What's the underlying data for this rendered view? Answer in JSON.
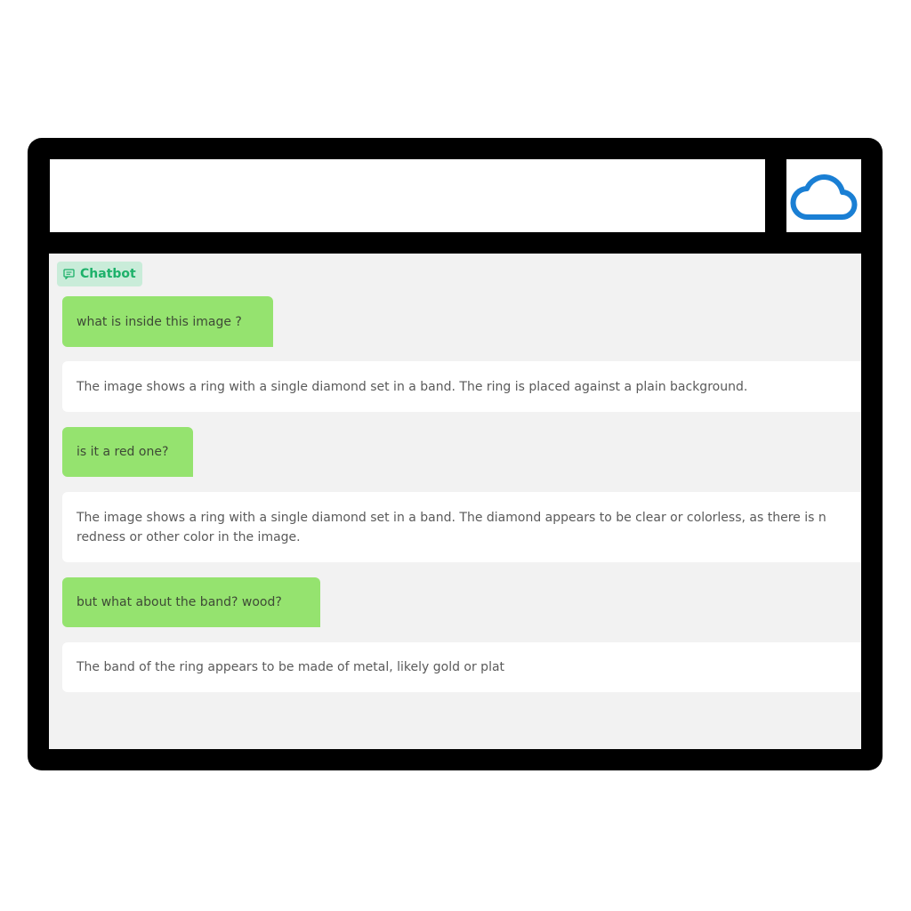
{
  "chat": {
    "label": "Chatbot",
    "messages": [
      {
        "role": "user",
        "text": "what is inside this image ?"
      },
      {
        "role": "bot",
        "lines": [
          "The image shows a ring with a single diamond set in a band. The ring is placed against a plain background."
        ]
      },
      {
        "role": "user",
        "text": "is it a red one?"
      },
      {
        "role": "bot",
        "lines": [
          "The image shows a ring with a single diamond set in a band. The diamond appears to be clear or colorless, as there is n",
          "redness or other color in the image."
        ]
      },
      {
        "role": "user",
        "text": "but what about the band? wood?"
      },
      {
        "role": "bot",
        "lines": [
          "The band of the ring appears to be made of metal, likely gold or plat"
        ]
      }
    ]
  },
  "icons": {
    "cloud": "cloud-icon",
    "chat": "chat-bubble-icon"
  },
  "colors": {
    "frame": "#000000",
    "user_bubble": "#95e36f",
    "bot_bubble": "#ffffff",
    "chat_background": "#f2f2f2",
    "label_text": "#1db16a",
    "cloud": "#1a7fd4"
  }
}
